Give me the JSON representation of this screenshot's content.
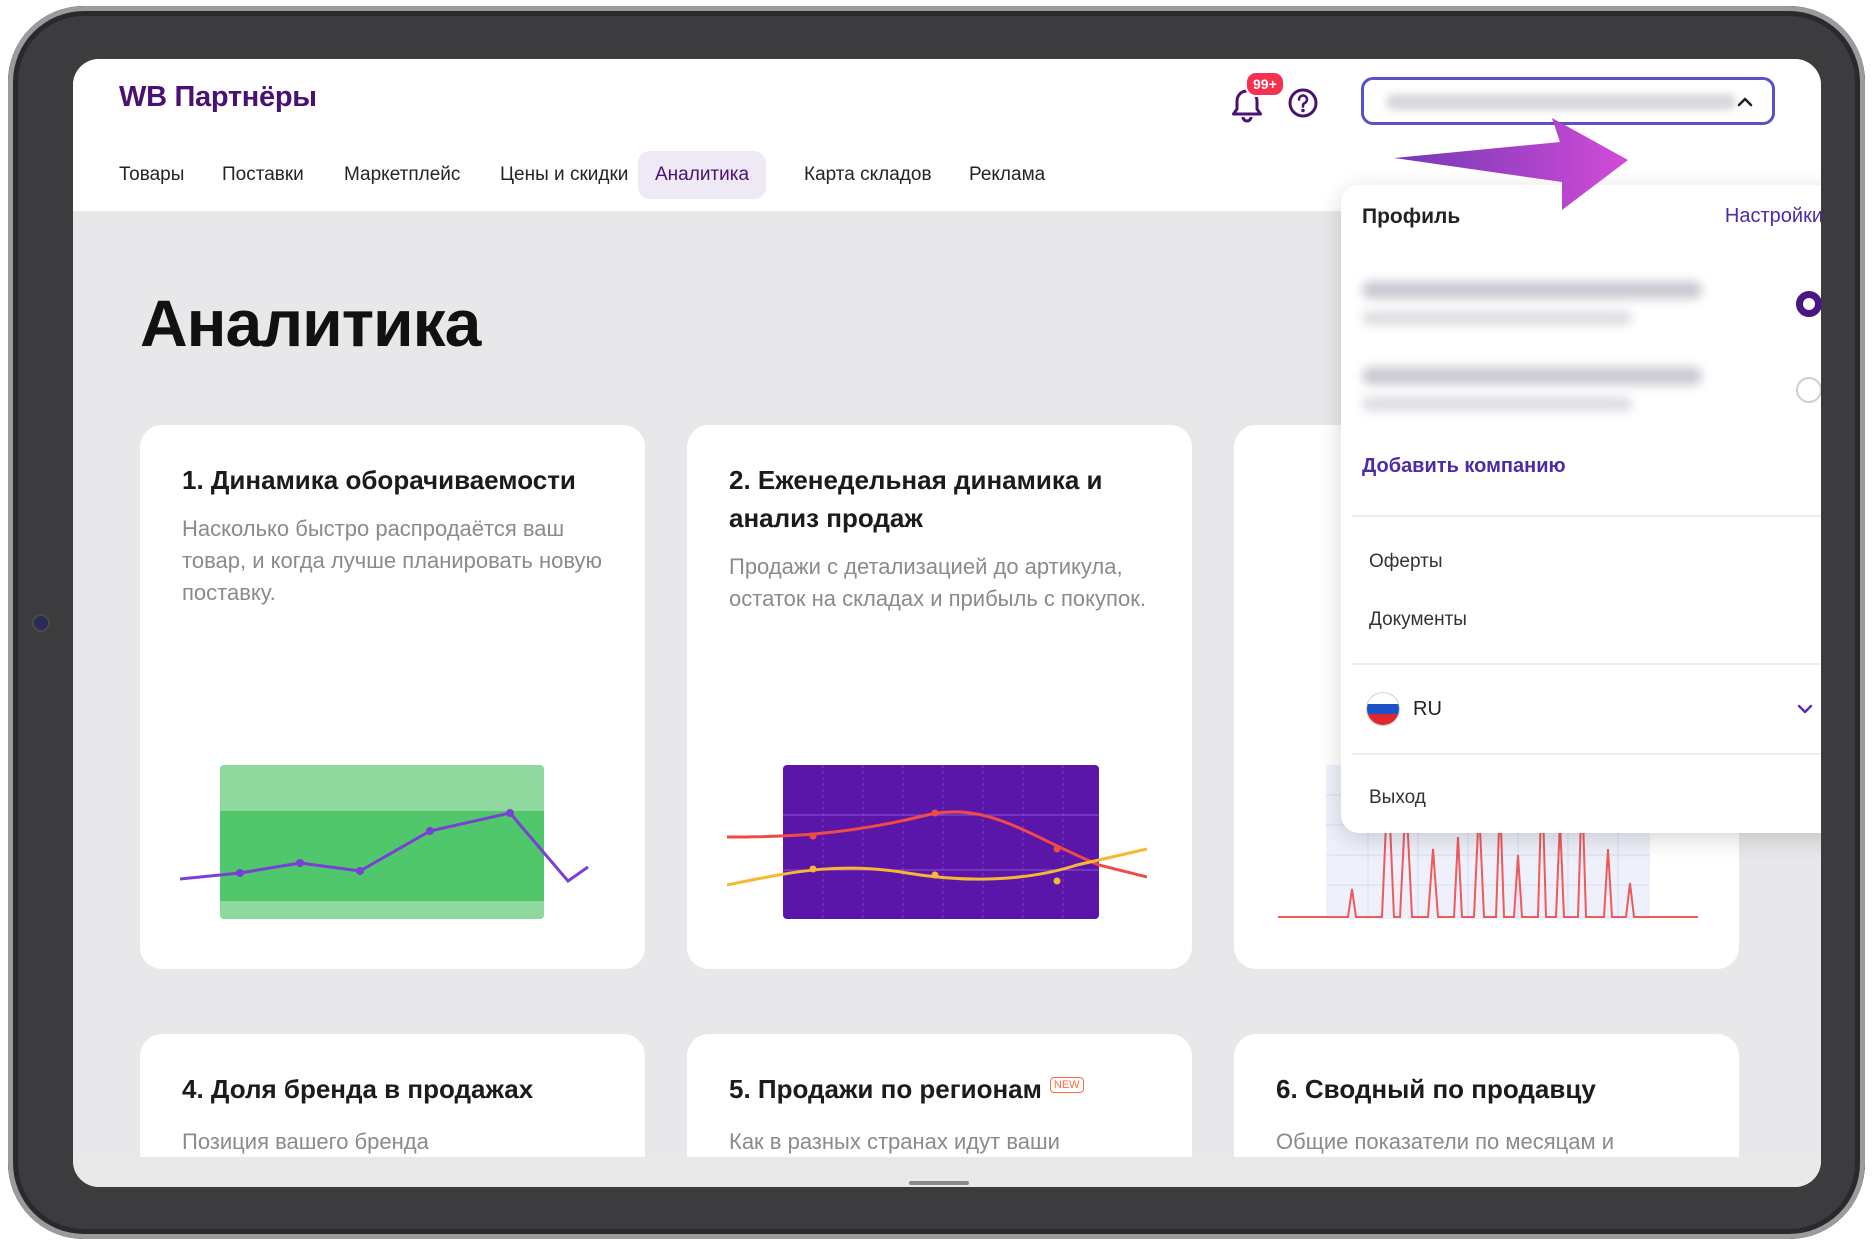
{
  "app": {
    "logo": "WB Партнёры",
    "notifications_badge": "99+"
  },
  "nav": {
    "items": [
      {
        "label": "Товары",
        "active": false
      },
      {
        "label": "Поставки",
        "active": false
      },
      {
        "label": "Маркетплейс",
        "active": false
      },
      {
        "label": "Цены и скидки",
        "active": false
      },
      {
        "label": "Аналитика",
        "active": true
      },
      {
        "label": "Карта складов",
        "active": false
      },
      {
        "label": "Реклама",
        "active": false
      }
    ]
  },
  "page": {
    "title": "Аналитика"
  },
  "cards": [
    {
      "title": "1. Динамика оборачиваемости",
      "description": "Насколько быстро распродаётся ваш товар, и когда лучше планировать новую поставку."
    },
    {
      "title": "2. Еженедельная динамика и анализ продаж",
      "description": "Продажи с детализацией до артикула, остаток на складах и прибыль с покупок."
    },
    {
      "title": "",
      "description": ""
    },
    {
      "title": "4. Доля бренда в продажах",
      "description": "Позиция вашего бренда"
    },
    {
      "title": "5. Продажи по регионам",
      "badge": "NEW",
      "description": "Как в разных странах идут ваши"
    },
    {
      "title": "6. Сводный по продавцу",
      "description": "Общие показатели по месяцам и"
    }
  ],
  "dropdown": {
    "header": "Профиль",
    "settings_link": "Настройки",
    "add_company": "Добавить компанию",
    "links": [
      "Оферты",
      "Документы"
    ],
    "language": "RU",
    "logout": "Выход"
  },
  "colors": {
    "brand": "#481173",
    "accent": "#4c2aa8",
    "highlight_arrow": "#c64fd6"
  }
}
